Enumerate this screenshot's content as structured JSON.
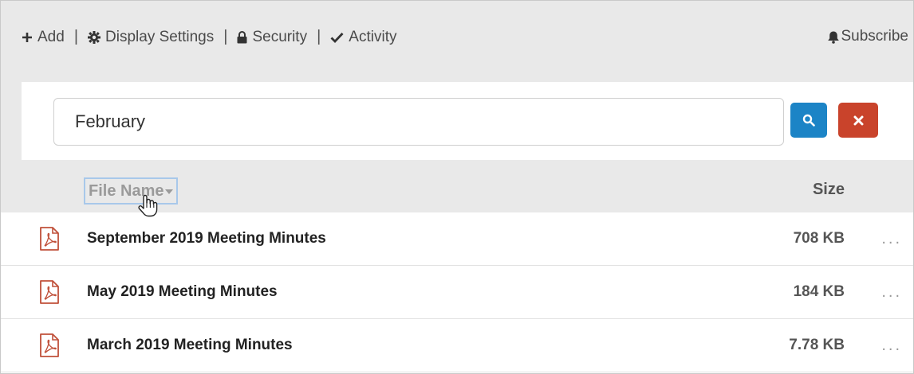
{
  "toolbar": {
    "add_label": "Add",
    "display_settings_label": "Display Settings",
    "security_label": "Security",
    "activity_label": "Activity",
    "subscribe_label": "Subscribe",
    "separator": "|"
  },
  "search": {
    "value": "February",
    "search_button_icon": "search-icon",
    "clear_button_icon": "close-icon"
  },
  "columns": {
    "file_name_label": "File Name",
    "size_label": "Size"
  },
  "files": [
    {
      "name": "September 2019 Meeting Minutes",
      "size": "708 KB",
      "icon": "pdf-file-icon",
      "more": "..."
    },
    {
      "name": "May 2019 Meeting Minutes",
      "size": "184 KB",
      "icon": "pdf-file-icon",
      "more": "..."
    },
    {
      "name": "March 2019 Meeting Minutes",
      "size": "7.78 KB",
      "icon": "pdf-file-icon",
      "more": "..."
    }
  ],
  "colors": {
    "toolbar_bg": "#e9e9e9",
    "search_button": "#1c84c6",
    "clear_button": "#c9432b",
    "pdf_icon": "#c0503a"
  }
}
